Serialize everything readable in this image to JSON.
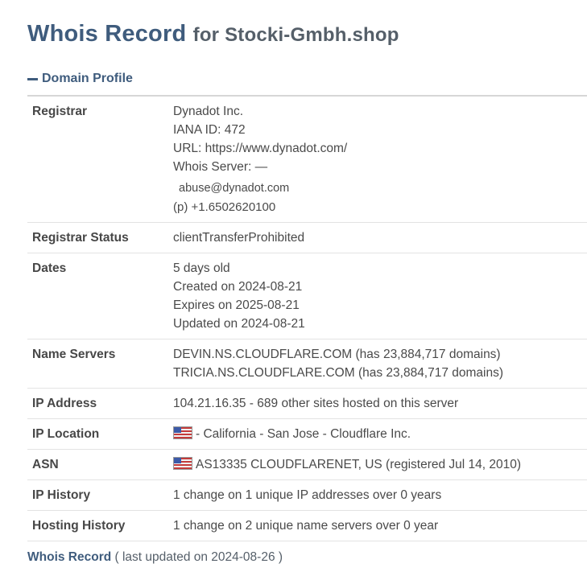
{
  "header": {
    "title": "Whois Record",
    "subtitle": "for Stocki-Gmbh.shop"
  },
  "section": {
    "toggle_label": "Domain Profile"
  },
  "rows": {
    "registrar": {
      "label": "Registrar",
      "name": "Dynadot Inc.",
      "iana": "IANA ID: 472",
      "url": "URL: https://www.dynadot.com/",
      "whois_server": "Whois Server: —",
      "email": "abuse@dynadot.com",
      "phone_prefix": "(p)",
      "phone": "+1.6502620100"
    },
    "status": {
      "label": "Registrar Status",
      "value": "clientTransferProhibited"
    },
    "dates": {
      "label": "Dates",
      "age": "5 days old",
      "created": "Created on 2024-08-21",
      "expires": "Expires on 2025-08-21",
      "updated": "Updated on 2024-08-21"
    },
    "name_servers": {
      "label": "Name Servers",
      "ns1": "DEVIN.NS.CLOUDFLARE.COM (has 23,884,717 domains)",
      "ns2": "TRICIA.NS.CLOUDFLARE.COM (has 23,884,717 domains)"
    },
    "ip_address": {
      "label": "IP Address",
      "value": "104.21.16.35 - 689 other sites hosted on this server"
    },
    "ip_location": {
      "label": "IP Location",
      "flag_icon": "us-flag-icon",
      "value": "- California - San Jose - Cloudflare Inc."
    },
    "asn": {
      "label": "ASN",
      "flag_icon": "us-flag-icon",
      "value": "AS13335 CLOUDFLARENET, US (registered Jul 14, 2010)"
    },
    "ip_history": {
      "label": "IP History",
      "value": "1 change on 1 unique IP addresses over 0 years"
    },
    "hosting_history": {
      "label": "Hosting History",
      "value": "1 change on 2 unique name servers over 0 year"
    }
  },
  "footer": {
    "title": "Whois Record",
    "note": "( last updated on 2024-08-26 )"
  },
  "colors": {
    "heading": "#3f5c7d",
    "text": "#4a4a4a",
    "divider": "#e3e3e3"
  }
}
